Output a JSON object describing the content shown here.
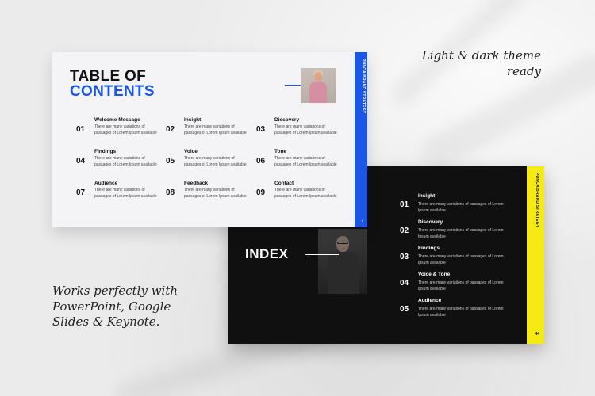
{
  "taglines": {
    "top": "Light & dark theme ready",
    "bottom": "Works perfectly with PowerPoint, Google Slides & Keynote."
  },
  "light_slide": {
    "title_line1": "TABLE OF",
    "title_line2": "CONTENTS",
    "strip_text": "PUNCA BRAND STRATEGY",
    "page_number": "4",
    "accent_color": "#1a57e6",
    "items": [
      {
        "num": "01",
        "title": "Welcome Message",
        "desc": "There are many variations of passages of Lorem Ipsum available"
      },
      {
        "num": "02",
        "title": "Insight",
        "desc": "There are many variations of passages of Lorem Ipsum available"
      },
      {
        "num": "03",
        "title": "Discovery",
        "desc": "There are many variations of passages of Lorem Ipsum available"
      },
      {
        "num": "04",
        "title": "Findings",
        "desc": "There are many variations of passages of Lorem Ipsum available"
      },
      {
        "num": "05",
        "title": "Voice",
        "desc": "There are many variations of passages of Lorem Ipsum available"
      },
      {
        "num": "06",
        "title": "Tone",
        "desc": "There are many variations of passages of Lorem Ipsum available"
      },
      {
        "num": "07",
        "title": "Audience",
        "desc": "There are many variations of passages of Lorem Ipsum available"
      },
      {
        "num": "08",
        "title": "Feedback",
        "desc": "There are many variations of passages of Lorem Ipsum available"
      },
      {
        "num": "09",
        "title": "Contact",
        "desc": "There are many variations of passages of Lorem Ipsum available"
      }
    ]
  },
  "dark_slide": {
    "title": "INDEX",
    "strip_text": "PUNCA BRAND STRATEGY",
    "page_number": "44",
    "accent_color": "#f5ea15",
    "items": [
      {
        "num": "01",
        "title": "Insight",
        "desc": "There are many variations of passages of Lorem Ipsum available"
      },
      {
        "num": "02",
        "title": "Discovery",
        "desc": "There are many variations of passages of Lorem Ipsum available"
      },
      {
        "num": "03",
        "title": "Findings",
        "desc": "There are many variations of passages of Lorem Ipsum available"
      },
      {
        "num": "04",
        "title": "Voice & Tone",
        "desc": "There are many variations of passages of Lorem Ipsum available"
      },
      {
        "num": "05",
        "title": "Audience",
        "desc": "There are many variations of passages of Lorem Ipsum available"
      }
    ]
  }
}
